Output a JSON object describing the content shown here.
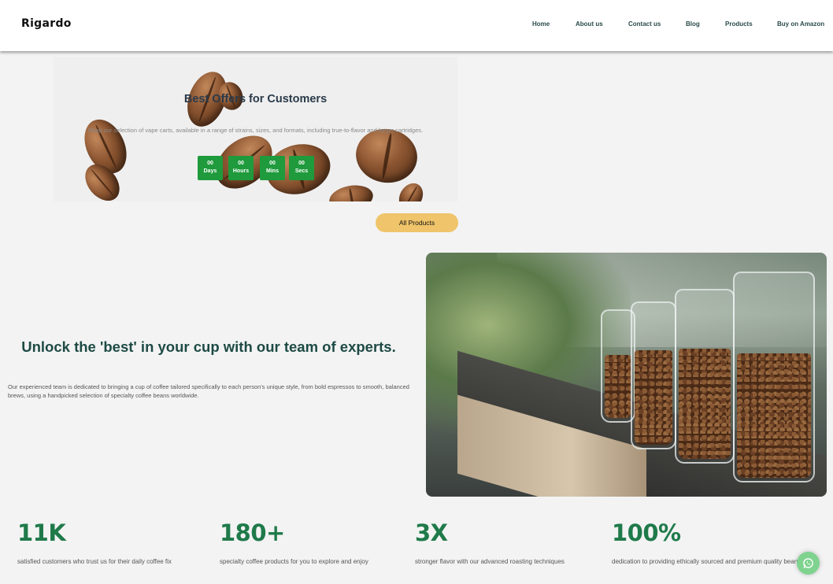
{
  "header": {
    "logo": "Rigardo",
    "nav": [
      "Home",
      "About us",
      "Contact us",
      "Blog",
      "Products",
      "Buy on Amazon"
    ]
  },
  "offers": {
    "title": "Best Offers for Customers",
    "description": "Shop our selection of vape carts, available in a range of strains, sizes, and formats, including true-to-flavor and larger cartridges.",
    "countdown": [
      {
        "value": "00",
        "unit": "Days"
      },
      {
        "value": "00",
        "unit": "Hours"
      },
      {
        "value": "00",
        "unit": "Mins"
      },
      {
        "value": "00",
        "unit": "Secs"
      }
    ]
  },
  "all_products_label": "All Products",
  "experts": {
    "title": "Unlock the 'best' in your cup with our team of experts.",
    "description": "Our experienced team is dedicated to bringing a cup of coffee tailored specifically to each person's unique style, from bold espressos to smooth, balanced brews, using a handpicked selection of specialty coffee beans worldwide."
  },
  "stats": [
    {
      "number": "11K",
      "label": "satisfied customers who trust us for their daily coffee fix"
    },
    {
      "number": "180+",
      "label": "specialty coffee products for you to explore and enjoy"
    },
    {
      "number": "3X",
      "label": "stronger flavor with our advanced roasting techniques"
    },
    {
      "number": "100%",
      "label": "dedication to providing ethically sourced and premium quality beans."
    }
  ],
  "colors": {
    "accent_green": "#1f9a3c",
    "stat_green": "#1f7a4a",
    "button_yellow": "#efc46a",
    "whatsapp_green": "#7fd38f"
  },
  "icons": {
    "chat": "whatsapp-icon"
  }
}
